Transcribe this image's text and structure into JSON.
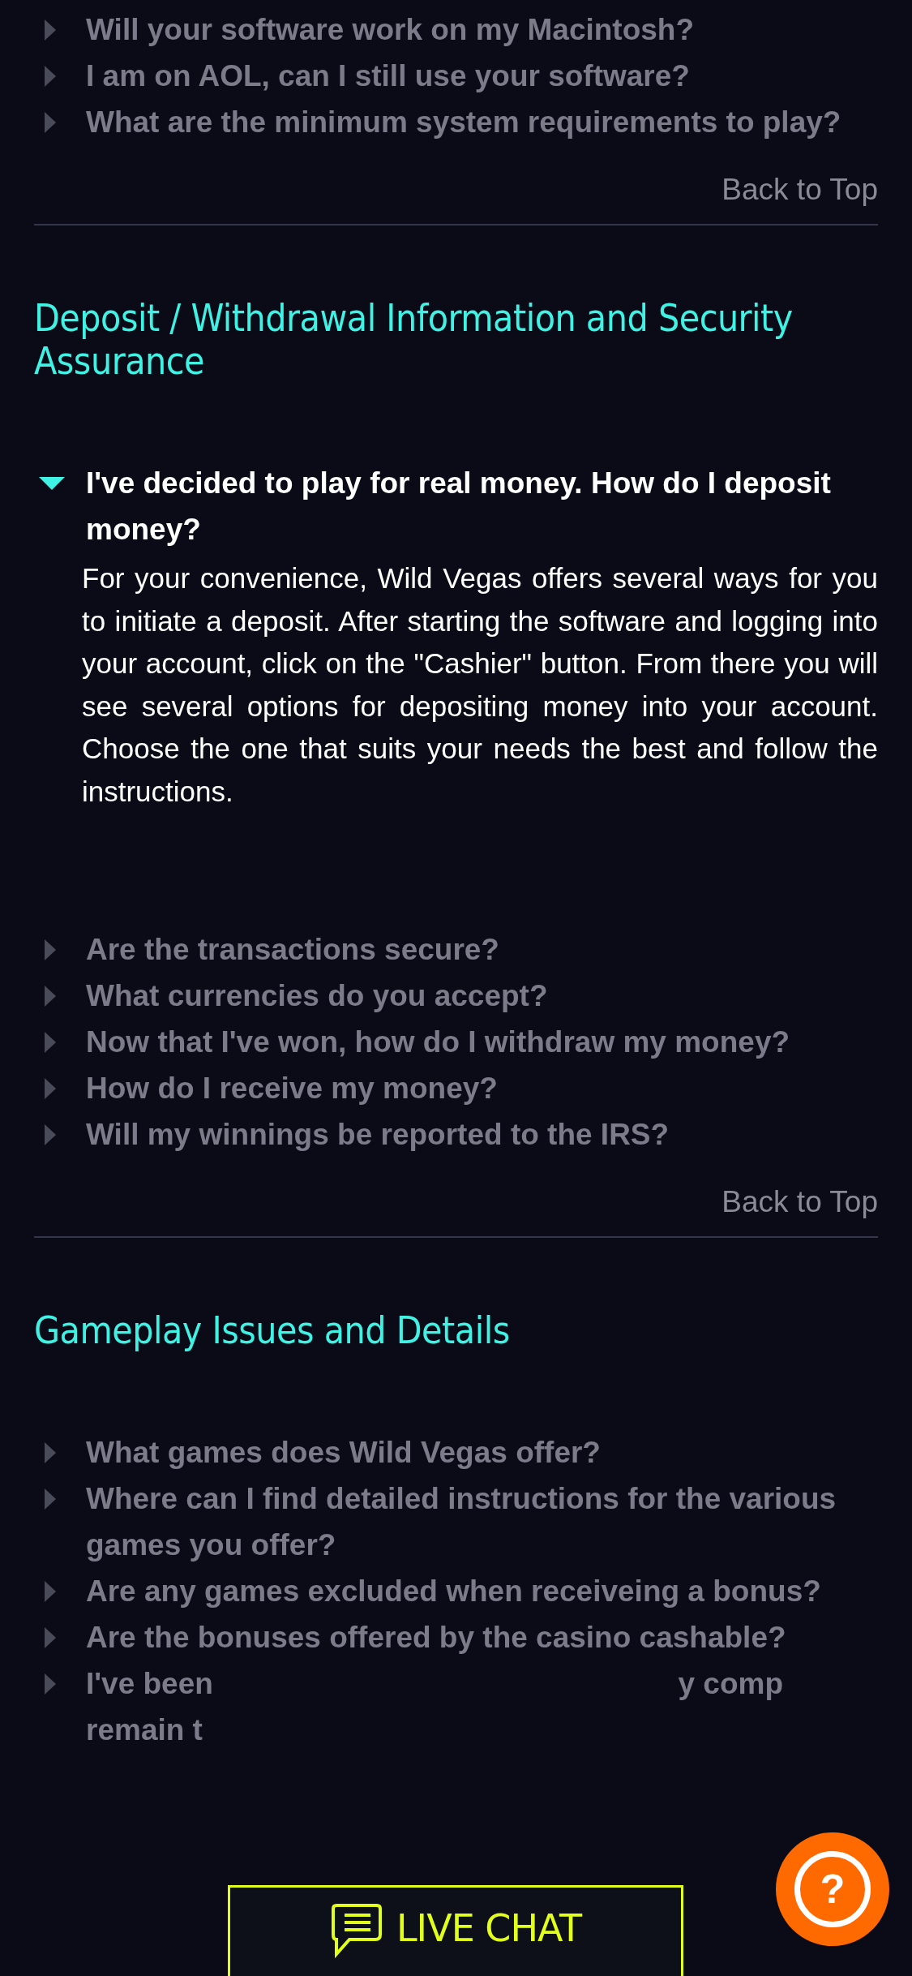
{
  "sections": [
    {
      "items": [
        {
          "kind": "question",
          "question": "Will your software work on my Macintosh?",
          "expanded": false
        },
        {
          "kind": "question",
          "question": "I am on AOL, can I still use your software?",
          "expanded": false
        },
        {
          "kind": "question",
          "question": "What are the minimum system requirements to play?",
          "expanded": false
        }
      ],
      "back_to_top": "Back to Top"
    },
    {
      "title": "Deposit / Withdrawal Information and Security Assurance",
      "items": [
        {
          "kind": "question",
          "question": "I've decided to play for real money. How do I deposit money?",
          "expanded": true,
          "answer": "For your convenience, Wild Vegas offers several ways for you to initiate a deposit. After starting the software and logging into your account, click on the \"Cashier\" button. From there you will see several options for depositing money into your account. Choose the one that suits your needs the best and follow the instructions."
        },
        {
          "kind": "question",
          "question": "Are the transactions secure?",
          "expanded": false
        },
        {
          "kind": "question",
          "question": "What currencies do you accept?",
          "expanded": false
        },
        {
          "kind": "question",
          "question": "Now that I've won, how do I withdraw my money?",
          "expanded": false
        },
        {
          "kind": "question",
          "question": "How do I receive my money?",
          "expanded": false
        },
        {
          "kind": "question",
          "question": "Will my winnings be reported to the IRS?",
          "expanded": false
        }
      ],
      "back_to_top": "Back to Top"
    },
    {
      "title": "Gameplay Issues and Details",
      "items": [
        {
          "kind": "question",
          "question": "What games does Wild Vegas offer?",
          "expanded": false
        },
        {
          "kind": "question",
          "question": "Where can I find detailed instructions for the various games you offer?",
          "expanded": false
        },
        {
          "kind": "question",
          "question": "Are any games excluded when receiveing a bonus?",
          "expanded": false
        },
        {
          "kind": "question",
          "question": "Are the bonuses offered by the casino cashable?",
          "expanded": false
        },
        {
          "kind": "partial",
          "fragments": [
            "I've been",
            "y comp",
            "remain t"
          ],
          "expanded": false
        }
      ]
    }
  ],
  "live_chat": {
    "label": "LIVE CHAT"
  },
  "help_button": {
    "label": "?"
  }
}
